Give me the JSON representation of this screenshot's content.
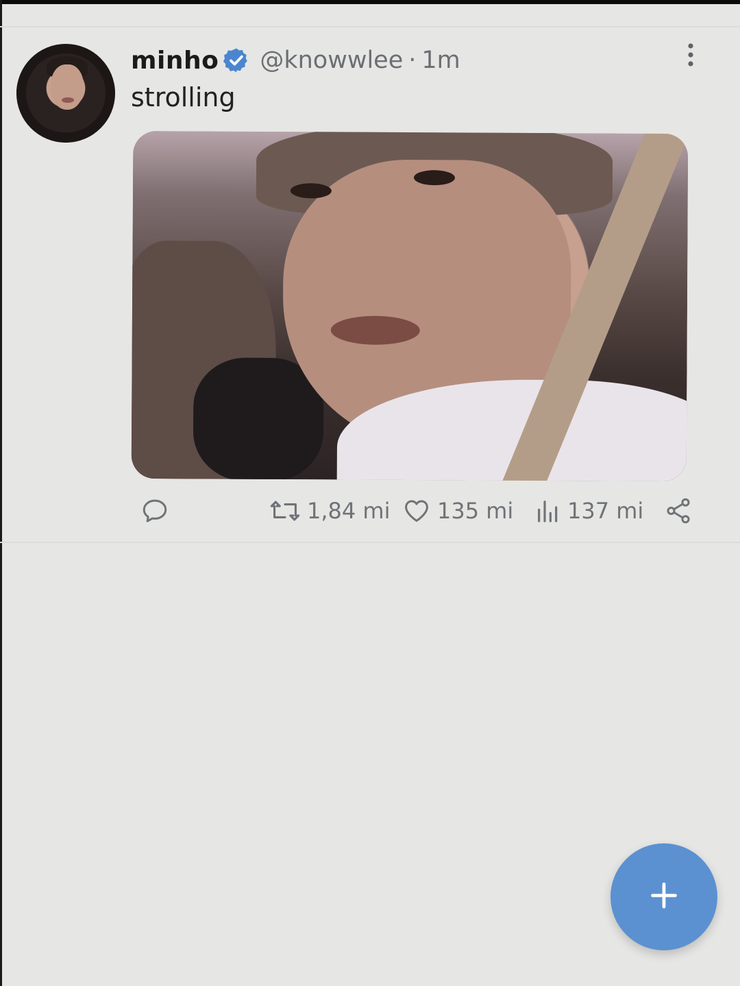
{
  "tweet": {
    "author": {
      "name": "minho",
      "handle": "@knowwlee",
      "verified": true,
      "avatar_icon": "profile-avatar"
    },
    "separator": "·",
    "time": "1m",
    "text": "strolling",
    "media_icon": "photo-selfie",
    "actions": {
      "reply": {
        "icon": "reply-icon"
      },
      "retweet": {
        "icon": "retweet-icon",
        "count": "1,84 mi"
      },
      "like": {
        "icon": "heart-icon",
        "count": "135 mi"
      },
      "views": {
        "icon": "views-icon",
        "count": "137 mi"
      },
      "share": {
        "icon": "share-icon"
      }
    }
  },
  "fab": {
    "icon": "plus-icon"
  },
  "colors": {
    "background": "#e6e6e4",
    "accent": "#5b91d0",
    "verified": "#4a86cf",
    "muted_text": "#6f7377"
  }
}
